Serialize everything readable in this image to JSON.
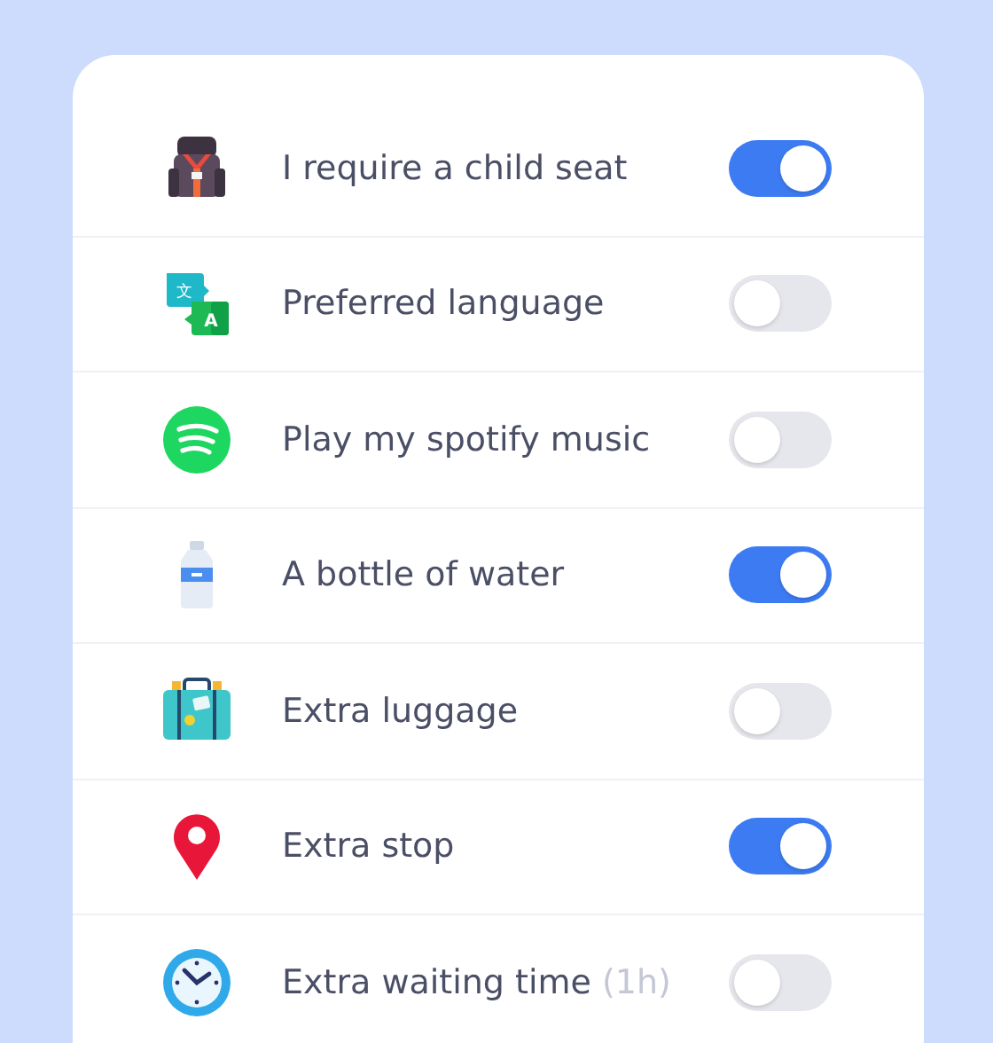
{
  "options": [
    {
      "kind": "child-seat",
      "label": "I require a child seat",
      "on": true
    },
    {
      "kind": "translate",
      "label": "Preferred language",
      "on": false,
      "icon_glyphs": [
        "文",
        "A"
      ]
    },
    {
      "kind": "music",
      "label": "Play my spotify music",
      "on": false
    },
    {
      "kind": "water",
      "label": "A bottle of water",
      "on": true
    },
    {
      "kind": "luggage",
      "label": "Extra luggage",
      "on": false
    },
    {
      "kind": "pin",
      "label": "Extra stop",
      "on": true
    },
    {
      "kind": "clock",
      "label": "Extra waiting time",
      "note": "(1h)",
      "on": false
    }
  ]
}
